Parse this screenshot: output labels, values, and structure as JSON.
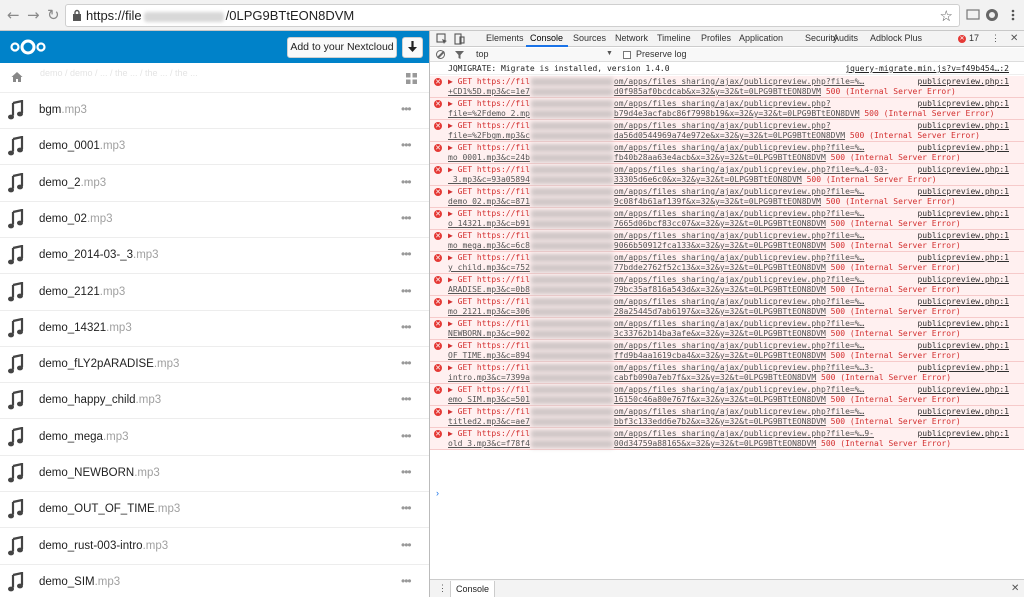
{
  "browser": {
    "back_glyph": "←",
    "forward_glyph": "→",
    "reload_glyph": "↻",
    "url_prefix": "https://file",
    "url_suffix": "/0LPG9BTtEON8DVM",
    "star_glyph": "☆",
    "icons": [
      "lock-icon",
      "star-icon",
      "cast-icon",
      "adblock-icon",
      "menu-icon"
    ]
  },
  "nextcloud": {
    "brand_color": "#0082c9",
    "add_button": "Add to your Nextcloud",
    "breadcrumb_ghost": "demo / demo / ... / the ... / the ... / the ...",
    "files": [
      {
        "name": "bgm",
        "ext": ".mp3"
      },
      {
        "name": "demo_0001",
        "ext": ".mp3"
      },
      {
        "name": "demo_2",
        "ext": ".mp3"
      },
      {
        "name": "demo_02",
        "ext": ".mp3"
      },
      {
        "name": "demo_2014-03-_3",
        "ext": ".mp3"
      },
      {
        "name": "demo_2121",
        "ext": ".mp3"
      },
      {
        "name": "demo_14321",
        "ext": ".mp3"
      },
      {
        "name": "demo_fLY2pARADISE",
        "ext": ".mp3"
      },
      {
        "name": "demo_happy_child",
        "ext": ".mp3"
      },
      {
        "name": "demo_mega",
        "ext": ".mp3"
      },
      {
        "name": "demo_NEWBORN",
        "ext": ".mp3"
      },
      {
        "name": "demo_OUT_OF_TIME",
        "ext": ".mp3"
      },
      {
        "name": "demo_rust-003-intro",
        "ext": ".mp3"
      },
      {
        "name": "demo_SIM",
        "ext": ".mp3"
      }
    ],
    "more_glyph": "•••"
  },
  "devtools": {
    "tabs": [
      "Elements",
      "Console",
      "Sources",
      "Network",
      "Timeline",
      "Profiles",
      "Application",
      "Security",
      "Audits",
      "Adblock Plus"
    ],
    "active_tab": "Console",
    "error_count": "17",
    "kebab_glyph": "⋮",
    "close_glyph": "✕",
    "context": "top",
    "context_arrow": "▼",
    "preserve_log": "Preserve log",
    "info_message": "JQMIGRATE: Migrate is installed, version 1.4.0",
    "info_source": "jquery-migrate.min.js?v=f49b454…:2",
    "error_source": "publicpreview.php:1",
    "error_status": "500 (Internal Server Error)",
    "errors": [
      {
        "l1a": "▶ GET https://fil",
        "l1b": "om/apps/files_sharing/ajax/publicpreview.php?file=%…",
        "l2a": "+CD1%5D.mp3&c=1e7",
        "l2b": "d0f985af0bcdcab&x=32&y=32&t=0LPG9BTtEON8DVM"
      },
      {
        "l1a": "▶ GET https://fil",
        "l1b": "om/apps/files_sharing/ajax/publicpreview.php?",
        "l2a": "file=%2Fdemo_2.mp",
        "l2b": "b79d4e3acfabc86f7998b19&x=32&y=32&t=0LPG9BTtEON8DVM"
      },
      {
        "l1a": "▶ GET https://fil",
        "l1b": "om/apps/files_sharing/ajax/publicpreview.php?",
        "l2a": "file=%2Fbgm.mp3&c",
        "l2b": "da56d0544969a74e972e&x=32&y=32&t=0LPG9BTtEON8DVM"
      },
      {
        "l1a": "▶ GET https://fil",
        "l1b": "om/apps/files_sharing/ajax/publicpreview.php?file=%…",
        "l2a": "mo_0001.mp3&c=24b",
        "l2b": "fb40b28aa63e4acb&x=32&y=32&t=0LPG9BTtEON8DVM"
      },
      {
        "l1a": "▶ GET https://fil",
        "l1b": "om/apps/files_sharing/ajax/publicpreview.php?file=%…4-03-",
        "l2a": "_3.mp3&c=93a05894",
        "l2b": "33305d6e6c0&x=32&y=32&t=0LPG9BTtEON8DVM"
      },
      {
        "l1a": "▶ GET https://fil",
        "l1b": "om/apps/files_sharing/ajax/publicpreview.php?file=%…",
        "l2a": "demo_02.mp3&c=871",
        "l2b": "9c08f4b61af139f&x=32&y=32&t=0LPG9BTtEON8DVM"
      },
      {
        "l1a": "▶ GET https://fil",
        "l1b": "om/apps/files_sharing/ajax/publicpreview.php?file=%…",
        "l2a": "o_14321.mp3&c=b91",
        "l2b": "7665d06bcf83cc07&x=32&y=32&t=0LPG9BTtEON8DVM"
      },
      {
        "l1a": "▶ GET https://fil",
        "l1b": "om/apps/files_sharing/ajax/publicpreview.php?file=%…",
        "l2a": "mo_mega.mp3&c=6c8",
        "l2b": "9066b50912fca133&x=32&y=32&t=0LPG9BTtEON8DVM"
      },
      {
        "l1a": "▶ GET https://fil",
        "l1b": "om/apps/files_sharing/ajax/publicpreview.php?file=%…",
        "l2a": "y_child.mp3&c=752",
        "l2b": "77bdde2762f52c13&x=32&y=32&t=0LPG9BTtEON8DVM"
      },
      {
        "l1a": "▶ GET https://fil",
        "l1b": "om/apps/files_sharing/ajax/publicpreview.php?file=%…",
        "l2a": "ARADISE.mp3&c=0b8",
        "l2b": "79bc35af816a543d&x=32&y=32&t=0LPG9BTtEON8DVM"
      },
      {
        "l1a": "▶ GET https://fil",
        "l1b": "om/apps/files_sharing/ajax/publicpreview.php?file=%…",
        "l2a": "mo_2121.mp3&c=306",
        "l2b": "28a25445d7ab6197&x=32&y=32&t=0LPG9BTtEON8DVM"
      },
      {
        "l1a": "▶ GET https://fil",
        "l1b": "om/apps/files_sharing/ajax/publicpreview.php?file=%…",
        "l2a": "NEWBORN.mp3&c=902",
        "l2b": "3c33762b14ba3afe&x=32&y=32&t=0LPG9BTtEON8DVM"
      },
      {
        "l1a": "▶ GET https://fil",
        "l1b": "om/apps/files_sharing/ajax/publicpreview.php?file=%…",
        "l2a": "OF_TIME.mp3&c=894",
        "l2b": "ffd9b4aa1619cba4&x=32&y=32&t=0LPG9BTtEON8DVM"
      },
      {
        "l1a": "▶ GET https://fil",
        "l1b": "om/apps/files_sharing/ajax/publicpreview.php?file=%…3-",
        "l2a": "intro.mp3&c=7399a",
        "l2b": "cabfb090a7eb7f&x=32&y=32&t=0LPG9BTtEON8DVM"
      },
      {
        "l1a": "▶ GET https://fil",
        "l1b": "om/apps/files_sharing/ajax/publicpreview.php?file=%…",
        "l2a": "emo_SIM.mp3&c=501",
        "l2b": "16150c46a80e767f&x=32&y=32&t=0LPG9BTtEON8DVM"
      },
      {
        "l1a": "▶ GET https://fil",
        "l1b": "om/apps/files_sharing/ajax/publicpreview.php?file=%…",
        "l2a": "titled2.mp3&c=ae7",
        "l2b": "bbf3c133edd6e7b2&x=32&y=32&t=0LPG9BTtEON8DVM"
      },
      {
        "l1a": "▶ GET https://fil",
        "l1b": "om/apps/files_sharing/ajax/publicpreview.php?file=%…9-",
        "l2a": "old_3.mp3&c=f78f4",
        "l2b": "00d34759a88165&x=32&y=32&t=0LPG9BTtEON8DVM"
      }
    ],
    "prompt_glyph": "›",
    "drawer_tab": "Console",
    "drawer_kebab": "⋮",
    "drawer_close": "✕"
  }
}
